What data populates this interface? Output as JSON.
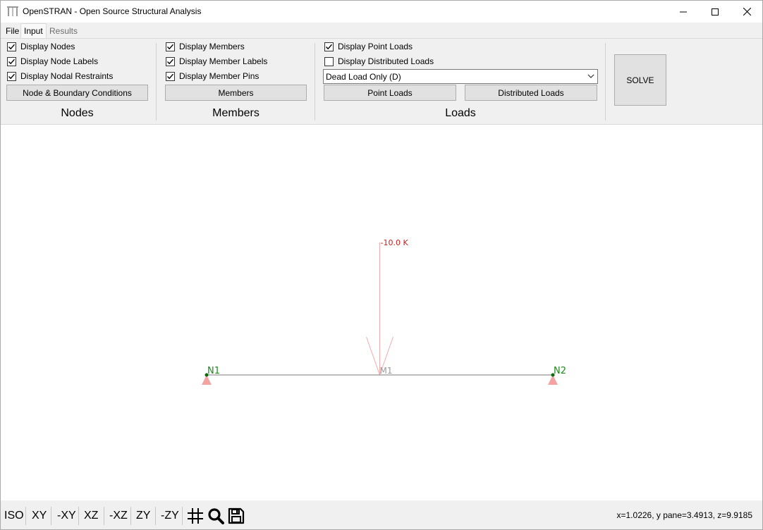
{
  "window": {
    "title": "OpenSTRAN - Open Source Structural Analysis",
    "icon": "frame-app-icon",
    "controls": [
      "minimize-icon",
      "maximize-icon",
      "close-icon"
    ]
  },
  "tabs": [
    {
      "label": "File",
      "state": "normal"
    },
    {
      "label": "Input",
      "state": "active"
    },
    {
      "label": "Results",
      "state": "disabled"
    }
  ],
  "ribbon": {
    "nodes": {
      "title": "Nodes",
      "checkboxes": [
        {
          "label": "Display Nodes",
          "checked": true
        },
        {
          "label": "Display Node Labels",
          "checked": true
        },
        {
          "label": "Display Nodal Restraints",
          "checked": true
        }
      ],
      "button": "Node & Boundary Conditions"
    },
    "members": {
      "title": "Members",
      "checkboxes": [
        {
          "label": "Display Members",
          "checked": true
        },
        {
          "label": "Display Member Labels",
          "checked": true
        },
        {
          "label": "Display Member Pins",
          "checked": true
        }
      ],
      "button": "Members"
    },
    "loads": {
      "title": "Loads",
      "checkboxes": [
        {
          "label": "Display Point Loads",
          "checked": true
        },
        {
          "label": "Display Distributed Loads",
          "checked": false
        }
      ],
      "combo_value": "Dead Load Only (D)",
      "point_button": "Point Loads",
      "distributed_button": "Distributed Loads"
    },
    "solve_label": "SOLVE"
  },
  "model": {
    "nodes": [
      {
        "label": "N1",
        "x": 0.0
      },
      {
        "label": "N2",
        "x": 1.0
      }
    ],
    "member": {
      "label": "M1"
    },
    "point_load": {
      "label": "-10.0 K",
      "position": 0.5
    },
    "colors": {
      "node_label": "#1f8a1f",
      "node_dot": "#0e6b0e",
      "member_line": "#7a7a7a",
      "member_label": "#9a9a9a",
      "load_line": "#f4aaaa",
      "load_label": "#d11b1b",
      "support": "#f4a3a3"
    }
  },
  "bottom": {
    "views": [
      "ISO",
      "XY",
      "-XY",
      "XZ",
      "-XZ",
      "ZY",
      "-ZY"
    ],
    "icons": [
      "grid-icon",
      "zoom-icon",
      "save-icon"
    ],
    "coords": "x=1.0226, y pane=3.4913, z=9.9185"
  }
}
